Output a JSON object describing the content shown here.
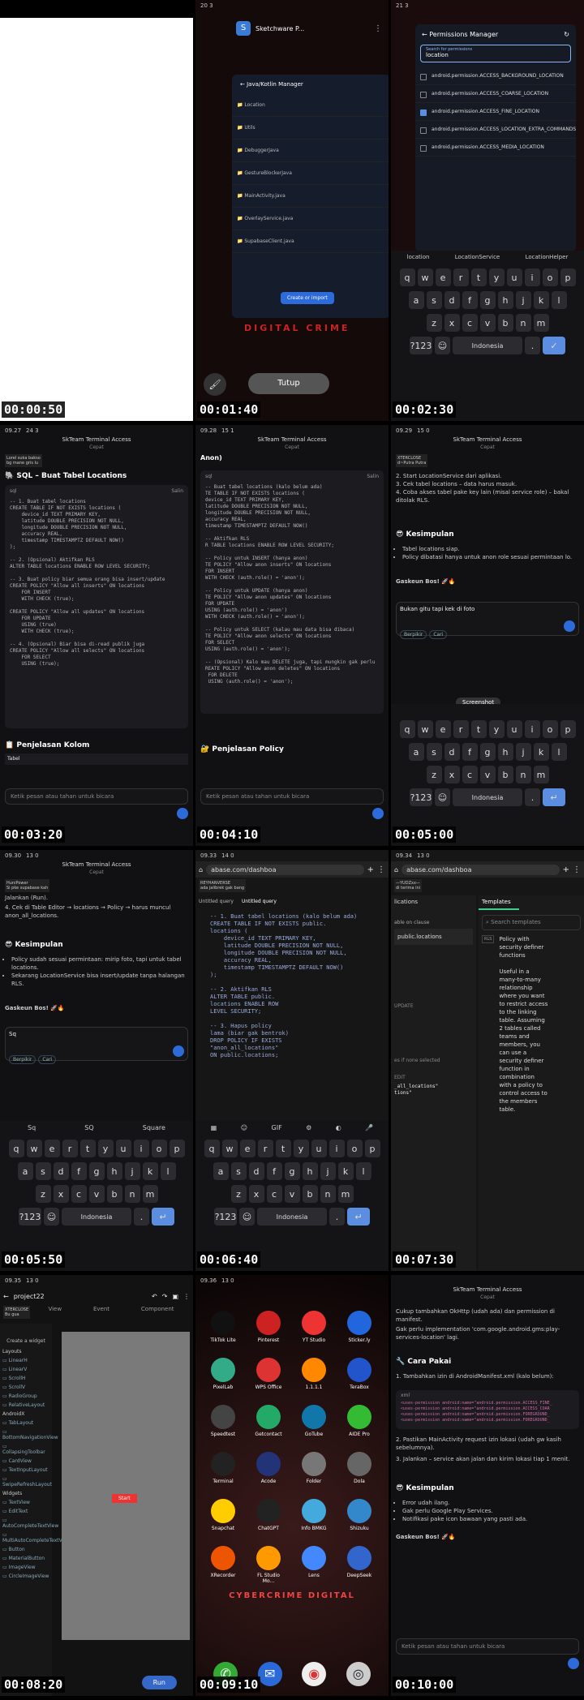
{
  "timestamps": [
    "00:00:50",
    "00:01:40",
    "00:02:30",
    "00:03:20",
    "00:04:10",
    "00:05:00",
    "00:05:50",
    "00:06:40",
    "00:07:30",
    "00:08:20",
    "00:09:10",
    "00:10:00"
  ],
  "frame2": {
    "status": "20 3",
    "app_title": "Sketchware P...",
    "dialog_title": "Java/Kotlin Manager",
    "files": [
      "Location",
      "Utils",
      "DebuggerJava",
      "GestureBlockerJava",
      "MainActivity.java",
      "OverlayService.java",
      "SupabaseClient.java"
    ],
    "create_btn": "Create or import",
    "close_btn": "Tutup",
    "banner": "DIGITAL CRIME"
  },
  "frame3": {
    "status": "21 3",
    "title": "Permissions Manager",
    "search_label": "Search for permissions",
    "search_value": "location",
    "perms": [
      "android.permission.ACCESS_BACKGROUND_LOCATION",
      "android.permission.ACCESS_COARSE_LOCATION",
      "android.permission.ACCESS_FINE_LOCATION",
      "android.permission.ACCESS_LOCATION_EXTRA_COMMANDS",
      "android.permission.ACCESS_MEDIA_LOCATION"
    ],
    "suggestions": [
      "location",
      "LocationService",
      "LocationHelper"
    ],
    "lang": "Indonesia",
    "kb_row1": [
      "q",
      "w",
      "e",
      "r",
      "t",
      "y",
      "u",
      "i",
      "o",
      "p"
    ],
    "kb_row2": [
      "a",
      "s",
      "d",
      "f",
      "g",
      "h",
      "j",
      "k",
      "l"
    ],
    "kb_row3": [
      "z",
      "x",
      "c",
      "v",
      "b",
      "n",
      "m"
    ]
  },
  "frame4": {
    "time": "09.27",
    "status": "24 3",
    "app": "SkTeam Terminal Access",
    "sub": "Cepat",
    "notice": "Lorel suka bakso\nbg mane gris lu",
    "heading": "SQL – Buat Tabel Locations",
    "code_lang": "sql",
    "copy": "Salin",
    "code": "-- 1. Buat tabel locations\nCREATE TABLE IF NOT EXISTS locations (\n    device_id TEXT PRIMARY KEY,\n    latitude DOUBLE PRECISION NOT NULL,\n    longitude DOUBLE PRECISION NOT NULL,\n    accuracy REAL,\n    timestamp TIMESTAMPTZ DEFAULT NOW()\n);\n\n-- 2. (Opsional) Aktifkan RLS\nALTER TABLE locations ENABLE ROW LEVEL SECURITY;\n\n-- 3. Buat policy biar semua orang bisa insert/update\nCREATE POLICY \"Allow all inserts\" ON locations\n    FOR INSERT\n    WITH CHECK (true);\n\nCREATE POLICY \"Allow all updates\" ON locations\n    FOR UPDATE\n    USING (true)\n    WITH CHECK (true);\n\n-- 4. (Opsional) Biar bisa di-read publik juga\nCREATE POLICY \"Allow all selects\" ON locations\n    FOR SELECT\n    USING (true);",
    "section2": "Penjelasan Kolom",
    "table_head": "Tabel",
    "input_ph": "Ketik pesan atau tahan untuk bicara"
  },
  "frame5": {
    "time": "09.28",
    "status": "15 1",
    "app": "SkTeam Terminal Access",
    "sub": "Cepat",
    "top": "Anon)",
    "code_lang": "sql",
    "copy": "Salin",
    "code": "-- Buat tabel locations (kalo belum ada)\nTE TABLE IF NOT EXISTS locations (\ndevice_id TEXT PRIMARY KEY,\nlatitude DOUBLE PRECISION NOT NULL,\nlongitude DOUBLE PRECISION NOT NULL,\naccuracy REAL,\ntimestamp TIMESTAMPTZ DEFAULT NOW()\n\n-- Aktifkan RLS\nR TABLE locations ENABLE ROW LEVEL SECURITY;\n\n-- Policy untuk INSERT (hanya anon)\nTE POLICY \"Allow anon inserts\" ON locations\nFOR INSERT\nWITH CHECK (auth.role() = 'anon');\n\n-- Policy untuk UPDATE (hanya anon)\nTE POLICY \"Allow anon updates\" ON locations\nFOR UPDATE\nUSING (auth.role() = 'anon')\nWITH CHECK (auth.role() = 'anon');\n\n-- Policy untuk SELECT (kalau mau data bisa dibaca)\nTE POLICY \"Allow anon selects\" ON locations\nFOR SELECT\nUSING (auth.role() = 'anon');\n\n-- (Opsional) Kalo mau DELETE juga, tapi mungkin gak perlu\nREATE POLICY \"Allow anon deletes\" ON locations\n FOR DELETE\n USING (auth.role() = 'anon');",
    "heading": "Penjelasan Policy",
    "input_ph": "Ketik pesan atau tahan untuk bicara"
  },
  "frame6": {
    "time": "09.29",
    "status": "15 0",
    "app": "SkTeam Terminal Access",
    "sub": "Cepat",
    "notice": "XTERCLOSE\nd~Putra Putra",
    "steps": [
      "2. Start LocationService dari aplikasi.",
      "3. Cek tabel locations – data harus masuk.",
      "4. Coba akses tabel pake key lain (misal service role) – bakal ditolak RLS."
    ],
    "heading": "Kesimpulan",
    "bullets": [
      "Tabel locations siap.",
      "Policy dibatasi hanya untuk anon role sesuai permintaan lo."
    ],
    "outro": "Gaskeun Bos! 🚀🔥",
    "input_value": "Bukan gitu tapi kek di foto",
    "chip1": "Berpikir",
    "chip2": "Cari",
    "popup": "Screenshot",
    "lang": "Indonesia",
    "kb_row1": [
      "q",
      "w",
      "e",
      "r",
      "t",
      "y",
      "u",
      "i",
      "o",
      "p"
    ],
    "kb_row2": [
      "a",
      "s",
      "d",
      "f",
      "g",
      "h",
      "j",
      "k",
      "l"
    ],
    "kb_row3": [
      "z",
      "x",
      "c",
      "v",
      "b",
      "n",
      "m"
    ]
  },
  "frame7": {
    "time": "09.30",
    "status": "13 0",
    "app": "SkTeam Terminal Access",
    "sub": "Cepat",
    "notice": "HuniPower\nSi pke supabase kah",
    "top1": "Jalankan (Run).",
    "top2": "4. Cek di Table Editor → locations → Policy → harus muncul anon_all_locations.",
    "heading": "Kesimpulan",
    "bullets": [
      "Policy sudah sesuai permintaan: mirip foto, tapi untuk tabel locations.",
      "Sekarang LocationService bisa insert/update tanpa halangan RLS."
    ],
    "outro": "Gaskeun Bos! 🚀🔥",
    "input_value": "Sq",
    "chip1": "Berpikir",
    "chip2": "Cari",
    "suggestions": [
      "Sq",
      "SQ",
      "Square"
    ],
    "lang": "Indonesia",
    "kb_row1": [
      "q",
      "w",
      "e",
      "r",
      "t",
      "y",
      "u",
      "i",
      "o",
      "p"
    ],
    "kb_row2": [
      "a",
      "s",
      "d",
      "f",
      "g",
      "h",
      "j",
      "k",
      "l"
    ],
    "kb_row3": [
      "z",
      "x",
      "c",
      "v",
      "b",
      "n",
      "m"
    ]
  },
  "frame8": {
    "time": "09.33",
    "status": "14 0",
    "url": "abase.com/dashboa",
    "notice": "REYHANVERSE\nada jalibrek gak bang",
    "tab1": "Untitled query",
    "tab2": "Untitled query",
    "code": "-- 1. Buat tabel locations (kalo belum ada)\nCREATE TABLE IF NOT EXISTS public.\nlocations (\n    device_id TEXT PRIMARY KEY,\n    latitude DOUBLE PRECISION NOT NULL,\n    longitude DOUBLE PRECISION NOT NULL,\n    accuracy REAL,\n    timestamp TIMESTAMPTZ DEFAULT NOW()\n);\n\n-- 2. Aktifkan RLS\nALTER TABLE public.\nlocations ENABLE ROW\nLEVEL SECURITY;\n\n-- 3. Hapus policy\nlama (biar gak bentrok)\nDROP POLICY IF EXISTS\n\"anon_all_locations\"\nON public.locations;",
    "lang": "Indonesia",
    "kb_row1": [
      "q",
      "w",
      "e",
      "r",
      "t",
      "y",
      "u",
      "i",
      "o",
      "p"
    ],
    "kb_row2": [
      "a",
      "s",
      "d",
      "f",
      "g",
      "h",
      "j",
      "k",
      "l"
    ],
    "kb_row3": [
      "z",
      "x",
      "c",
      "v",
      "b",
      "n",
      "m"
    ]
  },
  "frame9": {
    "time": "09.34",
    "status": "13 0",
    "url": "abase.com/dashboa",
    "notice": "—YUDZxx—\ndi terima ini",
    "tab": "Templates",
    "search_ph": "Search templates",
    "left_title": "lications",
    "left_sub": "able on clause",
    "left_table": "public.locations",
    "update": "UPDATE",
    "none_sel": "es if none selected",
    "edit": "EDIT",
    "code_frag": "_all_locations\"\ntions\"",
    "badge": "RLS",
    "template_text": "Policy with security definer functions\n\nUseful in a many-to-many relationship where you want to restrict access to the linking table. Assuming 2 tables called teams and members, you can use a security definer function in combination with a policy to control access to the members table."
  },
  "frame10": {
    "time": "09.35",
    "status": "13 0",
    "project": "project22",
    "notice": "XTERCLOSE\nBu gua",
    "tabs": [
      "View",
      "Event",
      "Component"
    ],
    "create_widget": "Create a widget",
    "layouts_label": "Layouts",
    "layouts": [
      "LinearH",
      "LinearV",
      "ScrollH",
      "ScrollV",
      "RadioGroup",
      "RelativeLayout"
    ],
    "androidx_label": "AndroidX",
    "androidx": [
      "TabLayout",
      "BottomNavigationView",
      "CollapsingToolbar",
      "CardView",
      "TextInputLayout",
      "SwipeRefreshLayout"
    ],
    "widgets_label": "Widgets",
    "widgets": [
      "TextView",
      "EditText",
      "AutoCompleteTextView",
      "MultiAutoCompleteTextView",
      "Button",
      "MaterialButton",
      "ImageView",
      "CircleImageView"
    ],
    "button_label": "Start",
    "run_btn": "Run"
  },
  "frame11": {
    "time": "09.36",
    "status": "13 0",
    "apps": [
      "TikTok Lite",
      "Pinterest",
      "YT Studio",
      "Sticker.ly",
      "PixelLab",
      "WPS Office",
      "1.1.1.1",
      "TeraBox",
      "Speedtest",
      "Getcontact",
      "GoTube",
      "AIDE Pro",
      "Terminal",
      "Acode",
      "Folder",
      "Dola",
      "Snapchat",
      "ChatGPT",
      "Info BMKG",
      "Shizuku",
      "XRecorder",
      "FL Studio Mo...",
      "Lens",
      "DeepSeek"
    ],
    "banner": "CYBERCRIME DIGITAL"
  },
  "frame12": {
    "app": "SkTeam Terminal Access",
    "sub": "Cepat",
    "intro1": "Cukup tambahkan OkHttp (udah ada) dan permission di manifest.",
    "intro2": "Gak perlu implementation 'com.google.android.gms:play-services-location' lagi.",
    "heading": "Cara Pakai",
    "steps": [
      "1. Tambahkan izin di AndroidManifest.xml (kalo belum):",
      "2. Pastikan MainActivity request izin lokasi (udah gw kasih sebelumnya).",
      "3. Jalankan – service akan jalan dan kirim lokasi tiap 1 menit."
    ],
    "code_lang": "xml",
    "code": "<uses-permission android:name=\"android.permission.ACCESS_FINE_\n<uses-permission android:name=\"android.permission.ACCESS_COAR\n<uses-permission android:name=\"android.permission.FOREGROUND_\n<uses-permission android:name=\"android.permission.FOREGROUND_",
    "heading2": "Kesimpulan",
    "bullets": [
      "Error udah ilang.",
      "Gak perlu Google Play Services.",
      "Notifikasi pake icon bawaan yang pasti ada."
    ],
    "outro": "Gaskeun Bos! 🚀🔥",
    "input_ph": "Ketik pesan atau tahan untuk bicara"
  }
}
